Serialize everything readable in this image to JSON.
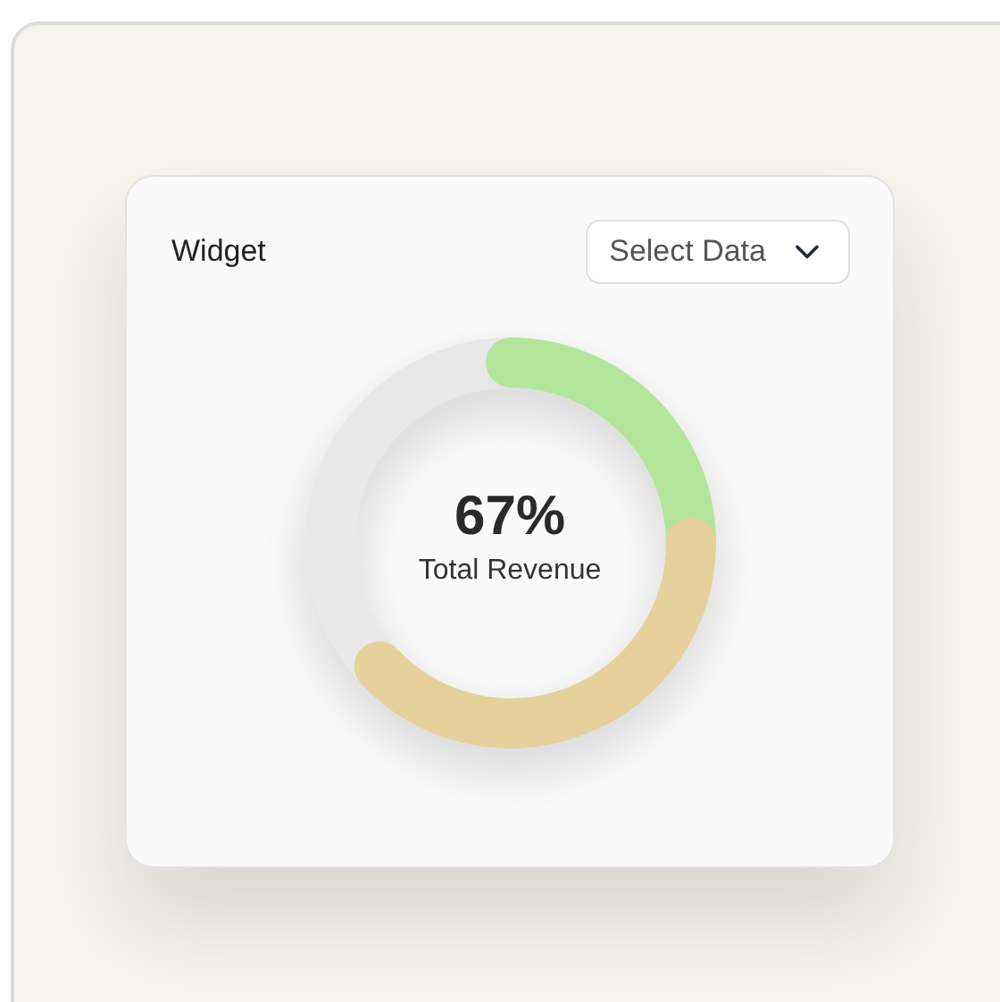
{
  "widget": {
    "title": "Widget",
    "select": {
      "label": "Select Data"
    }
  },
  "ring": {
    "level": 0.67,
    "value": "67%",
    "caption": "Total Revenue"
  }
}
